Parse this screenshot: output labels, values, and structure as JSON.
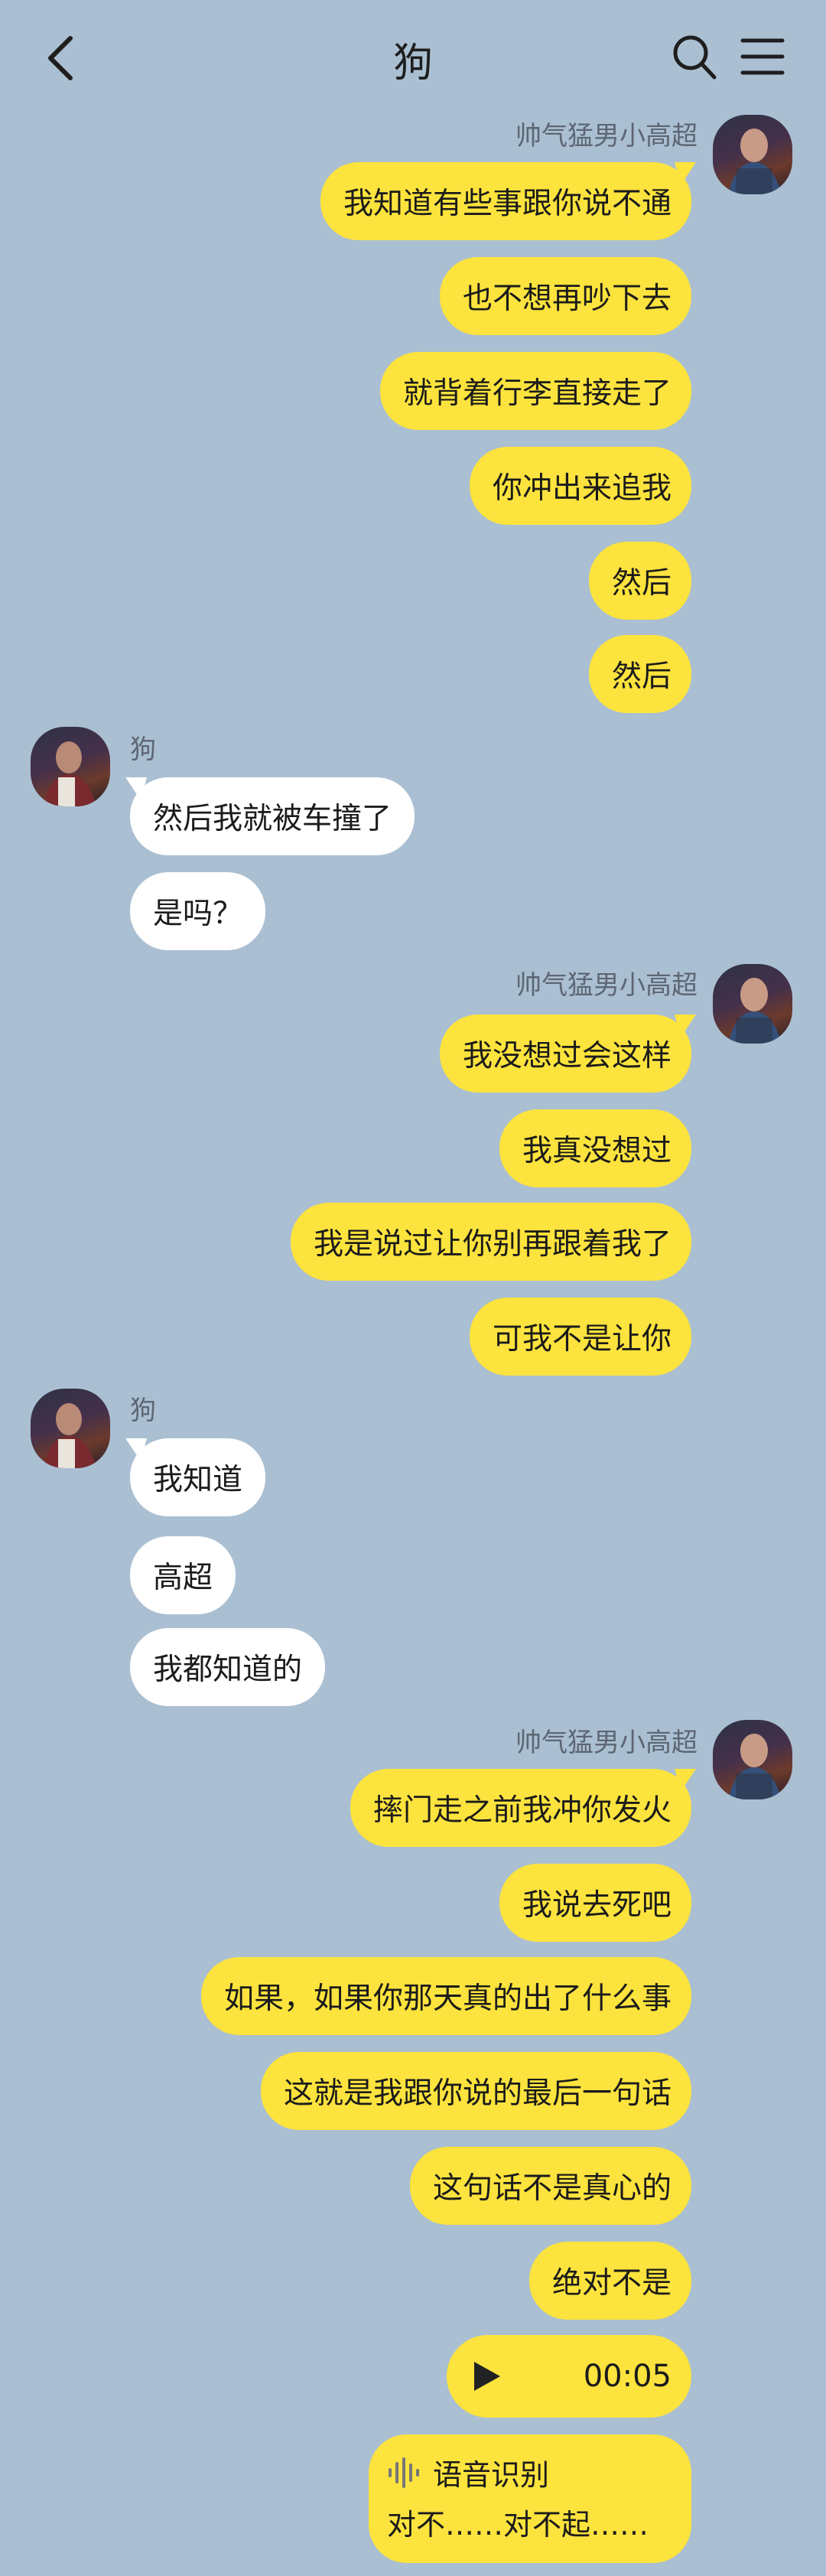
{
  "header": {
    "title": "狗"
  },
  "senders": {
    "me": "帅气猛男小高超",
    "other": "狗"
  },
  "groups": [
    {
      "messages": [
        "我知道有些事跟你说不通",
        "也不想再吵下去",
        "就背着行李直接走了",
        "你冲出来追我",
        "然后",
        "然后"
      ]
    },
    {
      "messages": [
        "然后我就被车撞了",
        "是吗？"
      ]
    },
    {
      "messages": [
        "我没想过会这样",
        "我真没想过",
        "我是说过让你别再跟着我了",
        "可我不是让你"
      ]
    },
    {
      "messages": [
        "我知道",
        "高超",
        "我都知道的"
      ]
    },
    {
      "messages": [
        "摔门走之前我冲你发火",
        "我说去死吧",
        "如果，如果你那天真的出了什么事",
        "这就是我跟你说的最后一句话",
        "这句话不是真心的",
        "绝对不是"
      ]
    }
  ],
  "voice": {
    "duration": "00:05"
  },
  "transcript": {
    "label": "语音识别",
    "text": "对不……对不起……"
  },
  "icons": {
    "back": "back-arrow-icon",
    "search": "search-icon",
    "menu": "menu-icon",
    "play": "play-icon",
    "wave": "voice-wave-icon"
  },
  "colors": {
    "background": "#aabfd2",
    "my_bubble": "#fde33d",
    "their_bubble": "#ffffff",
    "sender_name": "#5d6673"
  }
}
